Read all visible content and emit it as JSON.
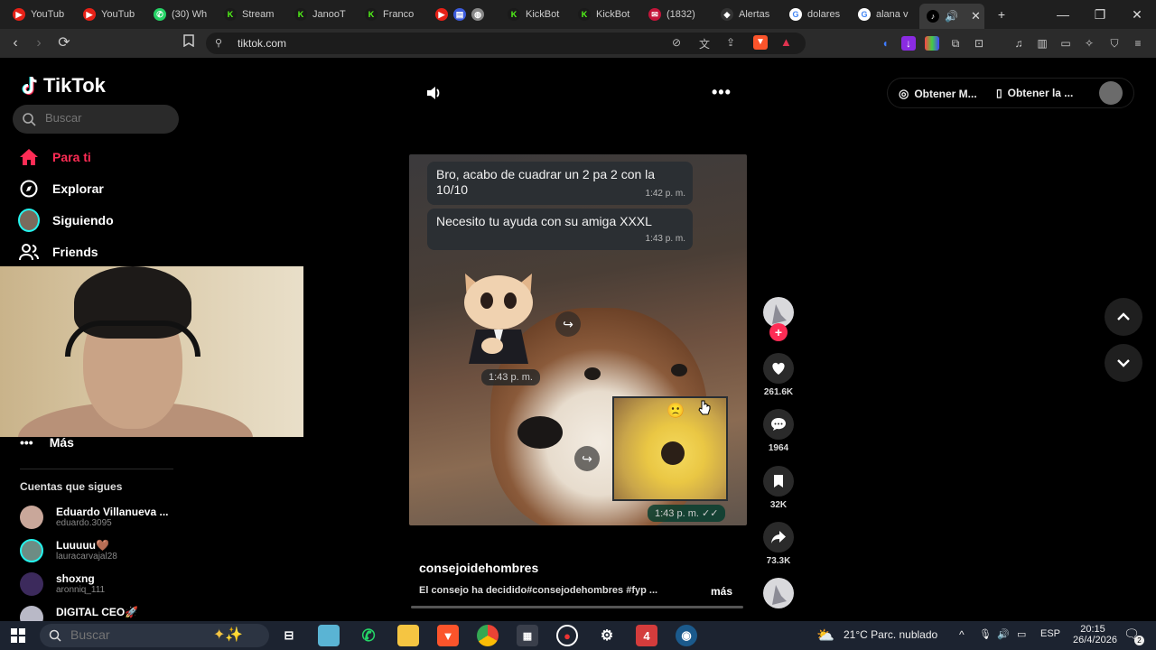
{
  "browser": {
    "tabs": [
      {
        "label": "YouTub",
        "color": "#e62117",
        "glyph": "▶"
      },
      {
        "label": "YouTub",
        "color": "#e62117",
        "glyph": "▶"
      },
      {
        "label": "(30) Wh",
        "color": "#25d366",
        "glyph": "✆"
      },
      {
        "label": "Stream",
        "color": "#53fc18",
        "glyph": "K"
      },
      {
        "label": "JanooT",
        "color": "#53fc18",
        "glyph": "K"
      },
      {
        "label": "Franco",
        "color": "#53fc18",
        "glyph": "K"
      },
      {
        "label": "",
        "color": "#e62117",
        "glyph": "▶"
      },
      {
        "label": "KickBot",
        "color": "#53fc18",
        "glyph": "K"
      },
      {
        "label": "KickBot",
        "color": "#53fc18",
        "glyph": "K"
      },
      {
        "label": "(1832)",
        "color": "#c3153a",
        "glyph": "✉"
      },
      {
        "label": "Alertas",
        "color": "#ffffff",
        "glyph": "◆"
      },
      {
        "label": "dolares",
        "color": "#4285f4",
        "glyph": "G"
      },
      {
        "label": "alana v",
        "color": "#4285f4",
        "glyph": "G"
      },
      {
        "label": "",
        "color": "#000000",
        "glyph": "♪"
      }
    ],
    "new_tab": "+",
    "url": "tiktok.com"
  },
  "tiktok": {
    "logo": "TikTok",
    "search_placeholder": "Buscar",
    "nav": [
      {
        "label": "Para ti",
        "icon": "home-icon"
      },
      {
        "label": "Explorar",
        "icon": "compass-icon"
      },
      {
        "label": "Siguiendo",
        "icon": "following-avatar"
      },
      {
        "label": "Friends",
        "icon": "friends-icon"
      }
    ],
    "more_label": "Más",
    "following_title": "Cuentas que sigues",
    "accounts": [
      {
        "name": "Eduardo Villanueva ...",
        "handle": "eduardo.3095",
        "color": "#c9a79a"
      },
      {
        "name": "Luuuuu🤎",
        "handle": "lauracarvajal28",
        "color": "#6d8c84"
      },
      {
        "name": "shoxng",
        "handle": "aronniq_111",
        "color": "#3c2a5c"
      },
      {
        "name": "DIGITAL CEO🚀",
        "handle": "",
        "color": "#b9b9c7"
      }
    ],
    "video": {
      "msg1": "Bro, acabo de cuadrar un 2 pa 2 con la 10/10",
      "msg1_time": "1:42 p. m.",
      "msg2": "Necesito tu ayuda con su amiga XXXL",
      "msg2_time": "1:43 p. m.",
      "sticker_time": "1:43 p. m.",
      "image_time": "1:43 p. m. ✓✓",
      "author": "consejoidehombres",
      "caption": "El consejo ha decidido#consejodehombres #fyp ...",
      "more": "más"
    },
    "actions": {
      "likes": "261.6K",
      "comments": "1964",
      "saves": "32K",
      "shares": "73.3K"
    },
    "top_right": {
      "get_coins": "Obtener M...",
      "get_app": "Obtener la ..."
    }
  },
  "taskbar": {
    "search_placeholder": "Buscar",
    "weather": "21°C  Parc. nublado",
    "lang": "ESP",
    "time": "20:15",
    "date": "26/4/2026",
    "notif_count": "2"
  }
}
